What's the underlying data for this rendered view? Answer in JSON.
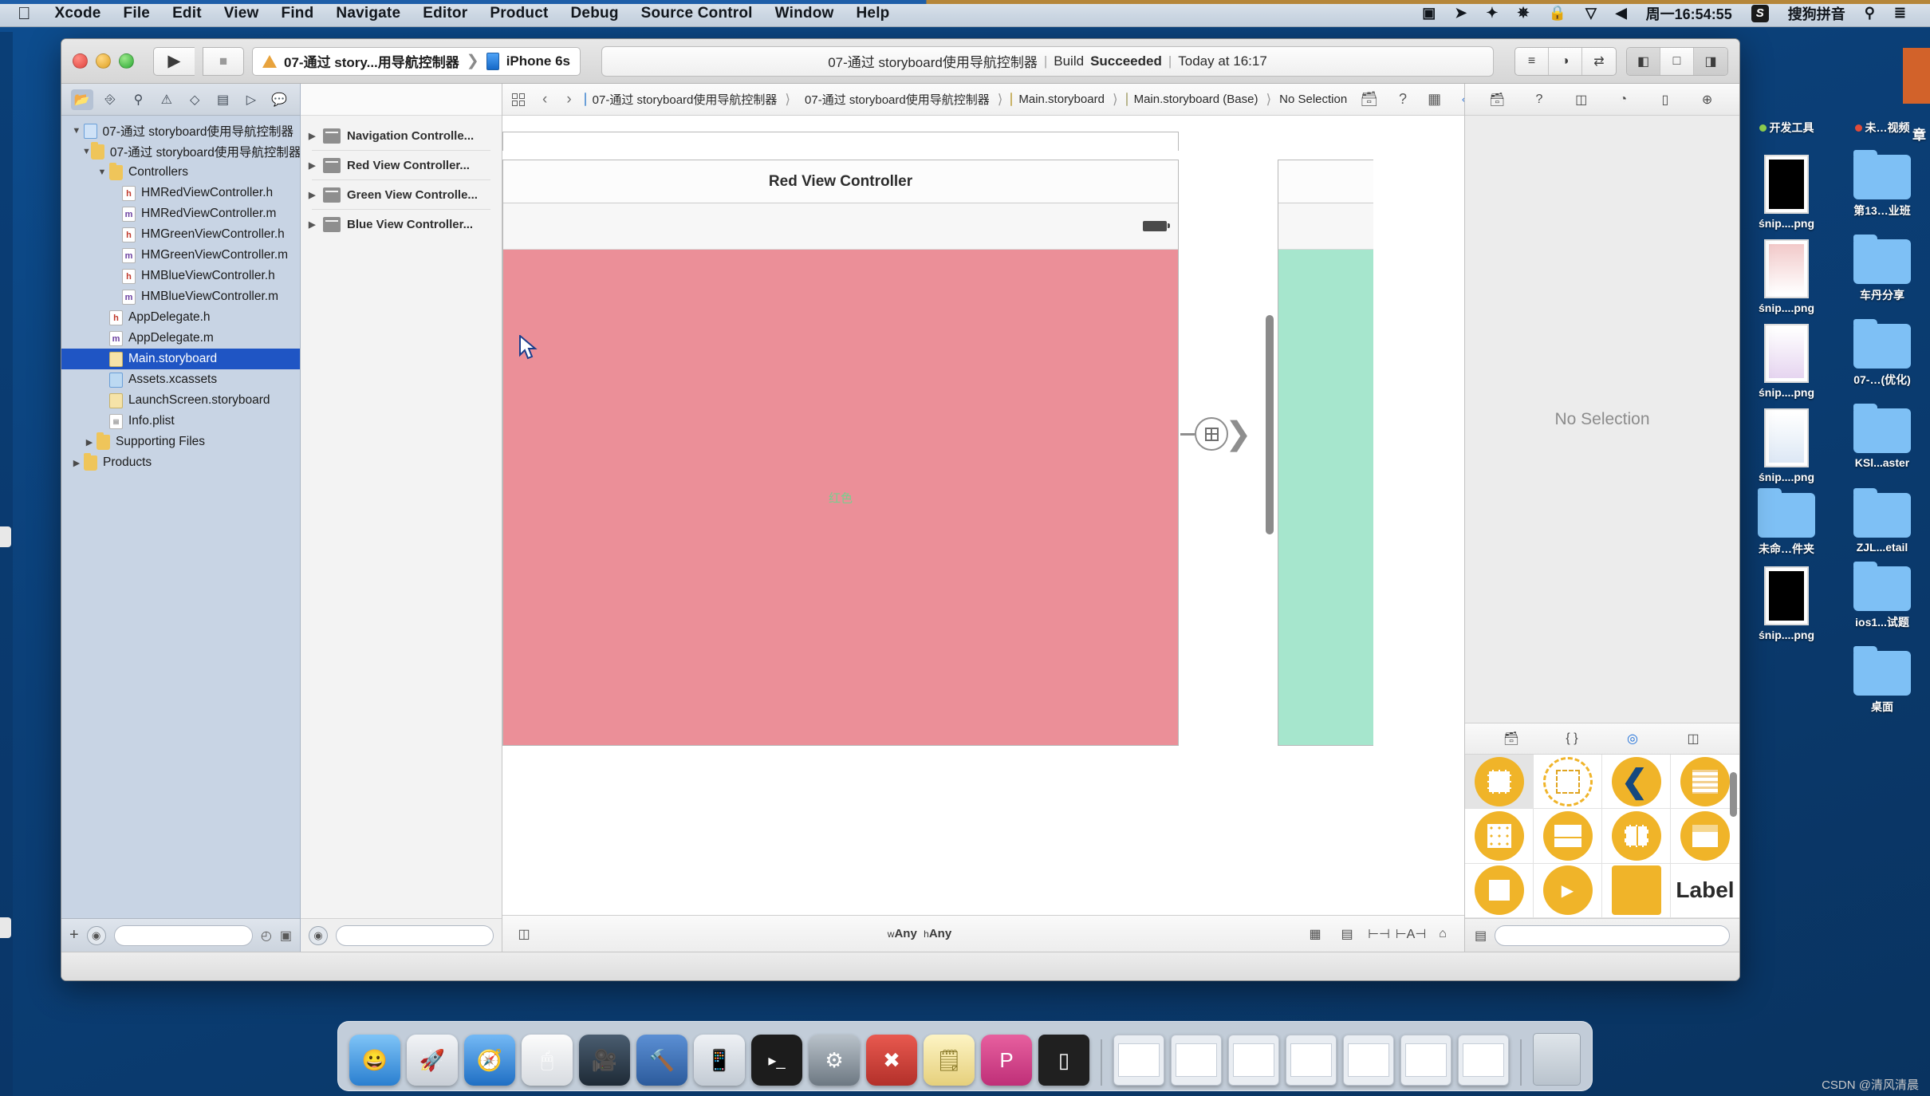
{
  "menubar": {
    "apple_icon": "apple-logo",
    "items": [
      "Xcode",
      "File",
      "Edit",
      "View",
      "Find",
      "Navigate",
      "Editor",
      "Product",
      "Debug",
      "Source Control",
      "Window",
      "Help"
    ],
    "right_items": [
      {
        "name": "screen-record-icon",
        "glyph": "▣"
      },
      {
        "name": "location-icon",
        "glyph": "➤"
      },
      {
        "name": "bluetooth-icon",
        "glyph": "✦"
      },
      {
        "name": "display-icon",
        "glyph": "✵"
      },
      {
        "name": "lock-icon",
        "glyph": "🔒"
      },
      {
        "name": "dropbox-icon",
        "glyph": "▽"
      },
      {
        "name": "volume-icon",
        "glyph": "◀"
      }
    ],
    "clock": "周一16:54:55",
    "input_badge": "S",
    "input_method": "搜狗拼音",
    "search_icon": "search-icon",
    "control_center_icon": "list-icon"
  },
  "toolbar": {
    "run_icon": "play-icon",
    "stop_icon": "stop-icon",
    "scheme_name": "07-通过 story...用导航控制器",
    "scheme_separator": "❯",
    "destination": "iPhone 6s",
    "status": {
      "project": "07-通过 storyboard使用导航控制器",
      "divider": "|",
      "build_prefix": "Build",
      "build_result": "Succeeded",
      "time": "Today at 16:17"
    },
    "editor_segments": [
      {
        "name": "standard-editor-button",
        "glyph": "≡",
        "active": false
      },
      {
        "name": "assistant-editor-button",
        "glyph": "◑",
        "active": false
      },
      {
        "name": "version-editor-button",
        "glyph": "⇄",
        "active": false
      }
    ],
    "view_segments": [
      {
        "name": "toggle-navigator-button",
        "glyph": "◧",
        "active": true
      },
      {
        "name": "toggle-debug-area-button",
        "glyph": "□",
        "active": false
      },
      {
        "name": "toggle-utilities-button",
        "glyph": "◨",
        "active": true
      }
    ]
  },
  "navigator": {
    "tabs": [
      {
        "name": "project-navigator-tab",
        "glyph": "🗀",
        "active": true
      },
      {
        "name": "source-control-navigator-tab",
        "glyph": "⎇",
        "active": false
      },
      {
        "name": "symbol-navigator-tab",
        "glyph": "🔍",
        "active": false
      },
      {
        "name": "issue-navigator-tab",
        "glyph": "⚠",
        "active": false
      },
      {
        "name": "test-navigator-tab",
        "glyph": "◇",
        "active": false
      },
      {
        "name": "debug-navigator-tab",
        "glyph": "▤",
        "active": false
      },
      {
        "name": "breakpoint-navigator-tab",
        "glyph": "▷",
        "active": false
      },
      {
        "name": "report-navigator-tab",
        "glyph": "💬",
        "active": false
      }
    ],
    "tree": [
      {
        "label": "07-通过 storyboard使用导航控制器",
        "indent": 0,
        "twisty": "▼",
        "icon": "proj",
        "selected": false
      },
      {
        "label": "07-通过 storyboard使用导航控制器",
        "indent": 1,
        "twisty": "▼",
        "icon": "folder",
        "selected": false
      },
      {
        "label": "Controllers",
        "indent": 2,
        "twisty": "▼",
        "icon": "folder",
        "selected": false
      },
      {
        "label": "HMRedViewController.h",
        "indent": 3,
        "twisty": "",
        "icon": "h",
        "selected": false
      },
      {
        "label": "HMRedViewController.m",
        "indent": 3,
        "twisty": "",
        "icon": "m",
        "selected": false
      },
      {
        "label": "HMGreenViewController.h",
        "indent": 3,
        "twisty": "",
        "icon": "h",
        "selected": false
      },
      {
        "label": "HMGreenViewController.m",
        "indent": 3,
        "twisty": "",
        "icon": "m",
        "selected": false
      },
      {
        "label": "HMBlueViewController.h",
        "indent": 3,
        "twisty": "",
        "icon": "h",
        "selected": false
      },
      {
        "label": "HMBlueViewController.m",
        "indent": 3,
        "twisty": "",
        "icon": "m",
        "selected": false
      },
      {
        "label": "AppDelegate.h",
        "indent": 2,
        "twisty": "",
        "icon": "h",
        "selected": false
      },
      {
        "label": "AppDelegate.m",
        "indent": 2,
        "twisty": "",
        "icon": "m",
        "selected": false
      },
      {
        "label": "Main.storyboard",
        "indent": 2,
        "twisty": "",
        "icon": "sb",
        "selected": true
      },
      {
        "label": "Assets.xcassets",
        "indent": 2,
        "twisty": "",
        "icon": "xca",
        "selected": false
      },
      {
        "label": "LaunchScreen.storyboard",
        "indent": 2,
        "twisty": "",
        "icon": "sb",
        "selected": false
      },
      {
        "label": "Info.plist",
        "indent": 2,
        "twisty": "",
        "icon": "gen",
        "selected": false
      },
      {
        "label": "Supporting Files",
        "indent": 2,
        "twisty": "▶",
        "icon": "folder",
        "selected": false
      },
      {
        "label": "Products",
        "indent": 1,
        "twisty": "▶",
        "icon": "folder",
        "selected": false
      }
    ],
    "filter_placeholder": "",
    "add_icon": "+",
    "filter_icon": "filter-icon",
    "recent_icon": "clock-icon",
    "unsaved_icon": "edited-icon"
  },
  "outline": {
    "items": [
      {
        "label": "Navigation Controlle...",
        "twisty": "▶"
      },
      {
        "label": "Red View Controller...",
        "twisty": "▶"
      },
      {
        "label": "Green View Controlle...",
        "twisty": "▶"
      },
      {
        "label": "Blue View Controller...",
        "twisty": "▶"
      }
    ],
    "filter_placeholder": ""
  },
  "breadcrumb": {
    "grid_icon": "related-items-icon",
    "back_glyph": "‹",
    "forward_glyph": "›",
    "items": [
      {
        "label": "07-通过 storyboard使用导航控制器",
        "icon": "proj"
      },
      {
        "label": "07-通过 storyboard使用导航控制器",
        "icon": "folder"
      },
      {
        "label": "Main.storyboard",
        "icon": "sb"
      },
      {
        "label": "Main.storyboard (Base)",
        "icon": "sbbase"
      },
      {
        "label": "No Selection",
        "icon": "none"
      }
    ],
    "right_icons": [
      {
        "name": "document-icon",
        "glyph": "🗋"
      },
      {
        "name": "help-icon",
        "glyph": "?"
      },
      {
        "name": "assistant-icon",
        "glyph": "▦"
      },
      {
        "name": "location-pin-icon",
        "glyph": "⬦"
      },
      {
        "name": "device-icon",
        "glyph": "▯"
      },
      {
        "name": "arrow-right-icon",
        "glyph": "→"
      }
    ]
  },
  "canvas": {
    "red_scene_title": "Red View Controller",
    "red_scene_label": "红色",
    "segue_icon": "segue-arrow-icon",
    "size_class_w_prefix": "w",
    "size_class_w": "Any",
    "size_class_h_prefix": "h",
    "size_class_h": "Any",
    "bottom_icons": [
      {
        "name": "view-as-icon",
        "glyph": "▦"
      },
      {
        "name": "embed-in-icon",
        "glyph": "▤"
      },
      {
        "name": "align-icon",
        "glyph": "⊢⊣"
      },
      {
        "name": "pin-icon",
        "glyph": "⊢A⊣"
      },
      {
        "name": "resolve-issues-icon",
        "glyph": "⌂"
      }
    ],
    "left_toggle_icon": "toggle-outline-icon"
  },
  "inspector": {
    "tabs": [
      {
        "name": "file-inspector-tab",
        "glyph": "🗋",
        "active": false
      },
      {
        "name": "quick-help-inspector-tab",
        "glyph": "?",
        "active": false
      },
      {
        "name": "identity-inspector-tab",
        "glyph": "◫",
        "active": false
      },
      {
        "name": "attributes-inspector-tab",
        "glyph": "◔",
        "active": false
      },
      {
        "name": "size-inspector-tab",
        "glyph": "▯",
        "active": false
      },
      {
        "name": "connections-inspector-tab",
        "glyph": "⊕",
        "active": false
      }
    ],
    "empty_text": "No Selection"
  },
  "library": {
    "tabs": [
      {
        "name": "file-template-library-tab",
        "glyph": "🗋",
        "active": false
      },
      {
        "name": "code-snippet-library-tab",
        "glyph": "{ }",
        "active": false
      },
      {
        "name": "object-library-tab",
        "glyph": "◎",
        "active": true
      },
      {
        "name": "media-library-tab",
        "glyph": "◫",
        "active": false
      }
    ],
    "objects": [
      {
        "name": "view-controller-object",
        "kind": "vc",
        "selected": true
      },
      {
        "name": "storyboard-reference-object",
        "kind": "hollow",
        "selected": false
      },
      {
        "name": "navigation-controller-object",
        "kind": "chev",
        "selected": false
      },
      {
        "name": "table-view-controller-object",
        "kind": "lines",
        "selected": false
      },
      {
        "name": "collection-view-controller-object",
        "kind": "dots",
        "selected": false
      },
      {
        "name": "tab-bar-controller-object",
        "kind": "panel",
        "selected": false
      },
      {
        "name": "split-view-controller-object",
        "kind": "book",
        "selected": false
      },
      {
        "name": "page-view-controller-object",
        "kind": "nav",
        "selected": false
      },
      {
        "name": "glkit-view-controller-object",
        "kind": "gl",
        "selected": false
      },
      {
        "name": "avkit-player-controller-object",
        "kind": "av",
        "selected": false
      },
      {
        "name": "object-cube",
        "kind": "cube",
        "selected": false
      },
      {
        "name": "label-object",
        "kind": "label",
        "label": "Label",
        "selected": false
      }
    ],
    "filter_placeholder": "",
    "list_view_icon": "list-view-icon",
    "search_icon": "search-icon"
  },
  "desktop": {
    "column_labels": [
      {
        "label": "开发工具",
        "dot": "#8fd14f"
      },
      {
        "label": "未…视频",
        "dot": "#e04b3a"
      }
    ],
    "icons": [
      {
        "label": "śnip....png",
        "type": "thumb-dark"
      },
      {
        "label": "第13…业班",
        "type": "folder"
      },
      {
        "label": "śnip....png",
        "type": "thumb-light"
      },
      {
        "label": "车丹分享",
        "type": "folder"
      },
      {
        "label": "śnip....png",
        "type": "thumb-light"
      },
      {
        "label": "07-…(优化)",
        "type": "folder"
      },
      {
        "label": "śnip....png",
        "type": "thumb-light"
      },
      {
        "label": "KSl...aster",
        "type": "folder"
      },
      {
        "label": "未命…件夹",
        "type": "folder"
      },
      {
        "label": "ZJL...etail",
        "type": "folder"
      },
      {
        "label": "śnip....png",
        "type": "thumb-dark"
      },
      {
        "label": "ios1...试题",
        "type": "folder"
      },
      {
        "label": "",
        "type": "none"
      },
      {
        "label": "桌面",
        "type": "folder"
      }
    ],
    "vertical_text": "章"
  },
  "dock": {
    "items": [
      {
        "name": "finder-dock-icon",
        "glyph": "🙂",
        "color": "#3e9cf0"
      },
      {
        "name": "launchpad-dock-icon",
        "glyph": "🚀",
        "color": "#d9dde3"
      },
      {
        "name": "safari-dock-icon",
        "glyph": "🧭",
        "color": "#2f8ed6"
      },
      {
        "name": "mouse-dock-icon",
        "glyph": "🖱",
        "color": "#f2f4f7"
      },
      {
        "name": "screenflow-dock-icon",
        "glyph": "🎬",
        "color": "#2b3a4a"
      },
      {
        "name": "xcode-dock-icon",
        "glyph": "🔨",
        "color": "#3d6ea8"
      },
      {
        "name": "simulator-dock-icon",
        "glyph": "📱",
        "color": "#dfe4ea"
      },
      {
        "name": "terminal-dock-icon",
        "glyph": "▸_",
        "color": "#1c1c1c"
      },
      {
        "name": "system-preferences-dock-icon",
        "glyph": "⚙",
        "color": "#9aa3ab"
      },
      {
        "name": "xmind-dock-icon",
        "glyph": "✖",
        "color": "#d6433b"
      },
      {
        "name": "notes-dock-icon",
        "glyph": "🗒",
        "color": "#f3e39a"
      },
      {
        "name": "keynote-dock-icon",
        "glyph": "P",
        "color": "#d64b8c"
      },
      {
        "name": "iphone-dock-icon",
        "glyph": "▯",
        "color": "#2b2b2b"
      }
    ],
    "windows": 7,
    "trash_name": "trash-dock-icon"
  },
  "watermark": "CSDN @清风清晨"
}
